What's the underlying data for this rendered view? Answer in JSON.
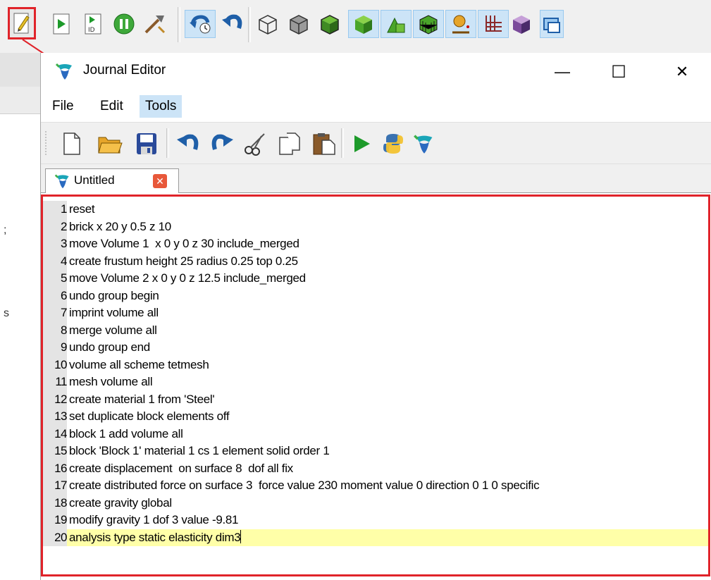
{
  "left_edge_text": [
    ";",
    "s"
  ],
  "journal": {
    "title": "Journal Editor",
    "window_controls": {
      "minimize": "—",
      "maximize": "☐",
      "close": "✕"
    },
    "menu": [
      "File",
      "Edit",
      "Tools"
    ],
    "tab": {
      "label": "Untitled",
      "close": "✕"
    },
    "lines": [
      {
        "n": "1",
        "text": "reset"
      },
      {
        "n": "2",
        "text": "brick x 20 y 0.5 z 10"
      },
      {
        "n": "3",
        "text": "move Volume 1  x 0 y 0 z 30 include_merged"
      },
      {
        "n": "4",
        "text": "create frustum height 25 radius 0.25 top 0.25"
      },
      {
        "n": "5",
        "text": "move Volume 2 x 0 y 0 z 12.5 include_merged"
      },
      {
        "n": "6",
        "text": "undo group begin"
      },
      {
        "n": "7",
        "text": "imprint volume all"
      },
      {
        "n": "8",
        "text": "merge volume all"
      },
      {
        "n": "9",
        "text": "undo group end"
      },
      {
        "n": "10",
        "text": "volume all scheme tetmesh"
      },
      {
        "n": "11",
        "text": "mesh volume all"
      },
      {
        "n": "12",
        "text": "create material 1 from 'Steel'"
      },
      {
        "n": "13",
        "text": "set duplicate block elements off"
      },
      {
        "n": "14",
        "text": "block 1 add volume all"
      },
      {
        "n": "15",
        "text": "block 'Block 1' material 1 cs 1 element solid order 1"
      },
      {
        "n": "16",
        "text": "create displacement  on surface 8  dof all fix"
      },
      {
        "n": "17",
        "text": "create distributed force on surface 3  force value 230 moment value 0 direction 0 1 0 specific"
      },
      {
        "n": "18",
        "text": "create gravity global"
      },
      {
        "n": "19",
        "text": "modify gravity 1 dof 3 value -9.81"
      },
      {
        "n": "20",
        "text": "analysis type static elasticity dim3"
      }
    ]
  },
  "colors": {
    "highlight_red": "#e0232a",
    "current_line": "#ffffa8",
    "active_menu": "#cce4f7"
  },
  "icons": {
    "top_toolbar": [
      "journal-editor-icon",
      "play-icon",
      "play-id-icon",
      "pause-icon",
      "tools-icon",
      "undo-history-icon",
      "undo-icon",
      "wireframe-cube-icon",
      "hidden-line-cube-icon",
      "shaded-cube-icon",
      "green-cube-icon",
      "shapes-icon",
      "mesh-cube-icon",
      "node-icon",
      "axes-icon",
      "purple-cube-icon",
      "window-icon"
    ],
    "editor_toolbar": [
      "new-file-icon",
      "open-folder-icon",
      "save-icon",
      "undo-icon",
      "redo-icon",
      "cut-icon",
      "copy-icon",
      "paste-icon",
      "run-icon",
      "python-icon",
      "cubit-icon"
    ]
  }
}
